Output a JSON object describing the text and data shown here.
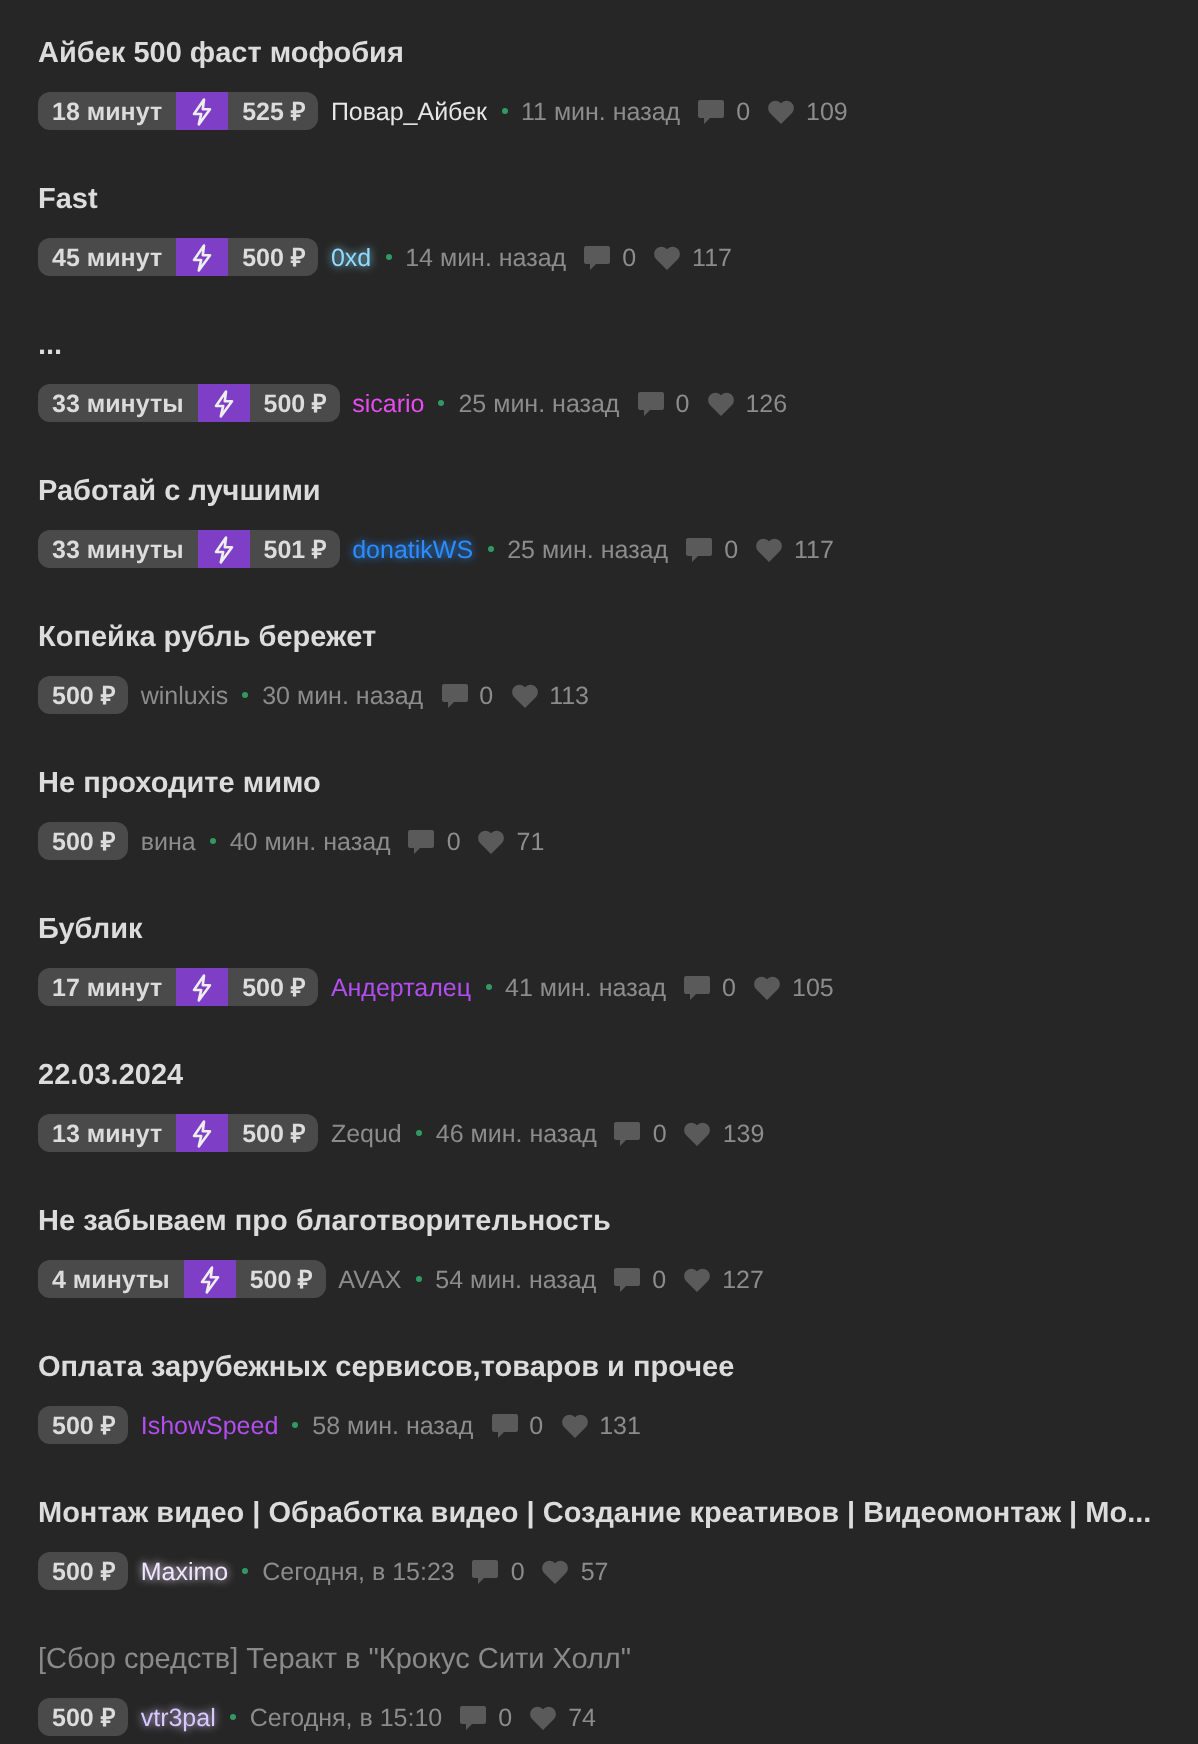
{
  "threads": [
    {
      "title": "Айбек 500 фаст мофобия",
      "dimmed": false,
      "duration": "18 минут",
      "boosted": true,
      "price": "525 ₽",
      "author": {
        "name": "Повар_Айбек",
        "color": "#e6e6e6",
        "glow": false
      },
      "time": "11 мин. назад",
      "comments": "0",
      "likes": "109"
    },
    {
      "title": "Fast",
      "dimmed": false,
      "duration": "45 минут",
      "boosted": true,
      "price": "500 ₽",
      "author": {
        "name": "0xd",
        "color": "#8fdcff",
        "glow": true
      },
      "time": "14 мин. назад",
      "comments": "0",
      "likes": "117"
    },
    {
      "title": "...",
      "dimmed": false,
      "duration": "33 минуты",
      "boosted": true,
      "price": "500 ₽",
      "author": {
        "name": "sicario",
        "color": "#e84cf0",
        "glow": false
      },
      "time": "25 мин. назад",
      "comments": "0",
      "likes": "126"
    },
    {
      "title": "Работай с лучшими",
      "dimmed": false,
      "duration": "33 минуты",
      "boosted": true,
      "price": "501 ₽",
      "author": {
        "name": "donatikWS",
        "color": "#2a8cff",
        "glow": true
      },
      "time": "25 мин. назад",
      "comments": "0",
      "likes": "117"
    },
    {
      "title": "Копейка рубль бережет",
      "dimmed": false,
      "boosted": false,
      "price": "500 ₽",
      "author": {
        "name": "winluxis",
        "color": "#8c8c8c",
        "glow": false
      },
      "time": "30 мин. назад",
      "comments": "0",
      "likes": "113"
    },
    {
      "title": "Не проходите мимо",
      "dimmed": false,
      "boosted": false,
      "price": "500 ₽",
      "author": {
        "name": "вина",
        "color": "#8c8c8c",
        "glow": false
      },
      "time": "40 мин. назад",
      "comments": "0",
      "likes": "71"
    },
    {
      "title": "Бублик",
      "dimmed": false,
      "duration": "17 минут",
      "boosted": true,
      "price": "500 ₽",
      "author": {
        "name": "Андерталец",
        "color": "#b24ef0",
        "glow": false
      },
      "time": "41 мин. назад",
      "comments": "0",
      "likes": "105"
    },
    {
      "title": "22.03.2024",
      "dimmed": false,
      "duration": "13 минут",
      "boosted": true,
      "price": "500 ₽",
      "author": {
        "name": "Zequd",
        "color": "#8c8c8c",
        "glow": false
      },
      "time": "46 мин. назад",
      "comments": "0",
      "likes": "139"
    },
    {
      "title": "Не забываем про благотворительность",
      "dimmed": false,
      "duration": "4 минуты",
      "boosted": true,
      "price": "500 ₽",
      "author": {
        "name": "AVAX",
        "color": "#8c8c8c",
        "glow": false
      },
      "time": "54 мин. назад",
      "comments": "0",
      "likes": "127"
    },
    {
      "title": "Оплата зарубежных сервисов,товаров и прочее",
      "dimmed": false,
      "boosted": false,
      "price": "500 ₽",
      "author": {
        "name": "IshowSpeed",
        "color": "#b24ef0",
        "glow": false
      },
      "time": "58 мин. назад",
      "comments": "0",
      "likes": "131"
    },
    {
      "title": "Монтаж видео | Обработка видео | Создание креативов | Видеомонтаж | Мо...",
      "dimmed": false,
      "boosted": false,
      "price": "500 ₽",
      "author": {
        "name": "Maximo",
        "color": "#f0e6ff",
        "glow": true
      },
      "time": "Сегодня, в 15:23",
      "comments": "0",
      "likes": "57"
    },
    {
      "title": "[Сбор средств] Теракт в \"Крокус Сити Холл\"",
      "dimmed": true,
      "boosted": false,
      "price": "500 ₽",
      "author": {
        "name": "vtr3pal",
        "color": "#d8c8ff",
        "glow": true
      },
      "time": "Сегодня, в 15:10",
      "comments": "0",
      "likes": "74"
    }
  ]
}
